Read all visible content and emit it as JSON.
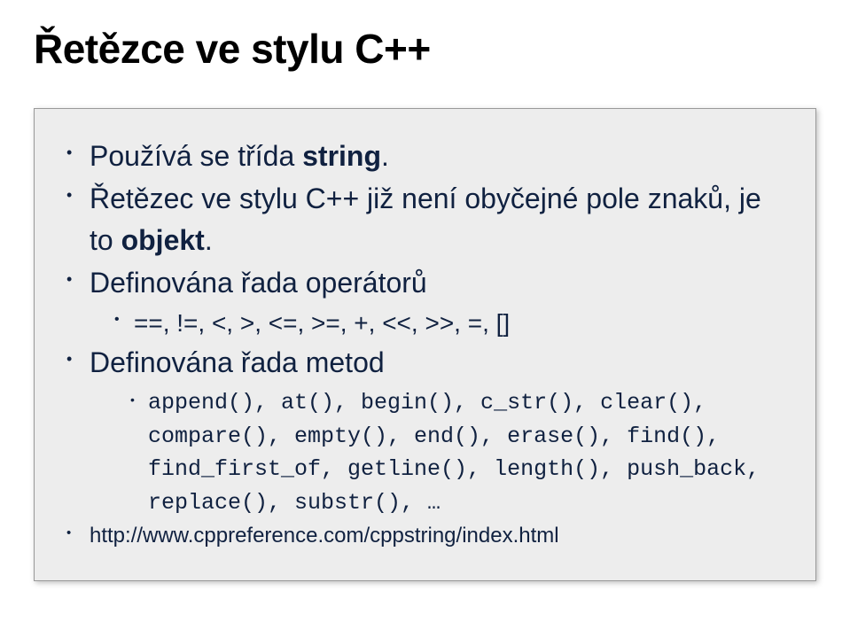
{
  "title": "Řetězce ve stylu C++",
  "bullets": {
    "b0_prefix": "Používá se třída ",
    "b0_bold": "string",
    "b0_suffix": ".",
    "b1_prefix": "Řetězec ve stylu C++ již není obyčejné pole znaků, je to ",
    "b1_bold": "objekt",
    "b1_suffix": ".",
    "b2": "Definována řada operátorů",
    "b2_sub": "==, !=, <, >, <=, >=, +, <<, >>, =, []",
    "b3": "Definována řada metod",
    "b3_sub": "append(), at(), begin(), c_str(), clear(), compare(), empty(), end(), erase(), find(), find_first_of, getline(), length(), push_back, replace(), substr(), …",
    "b4": "http://www.cppreference.com/cppstring/index.html"
  }
}
